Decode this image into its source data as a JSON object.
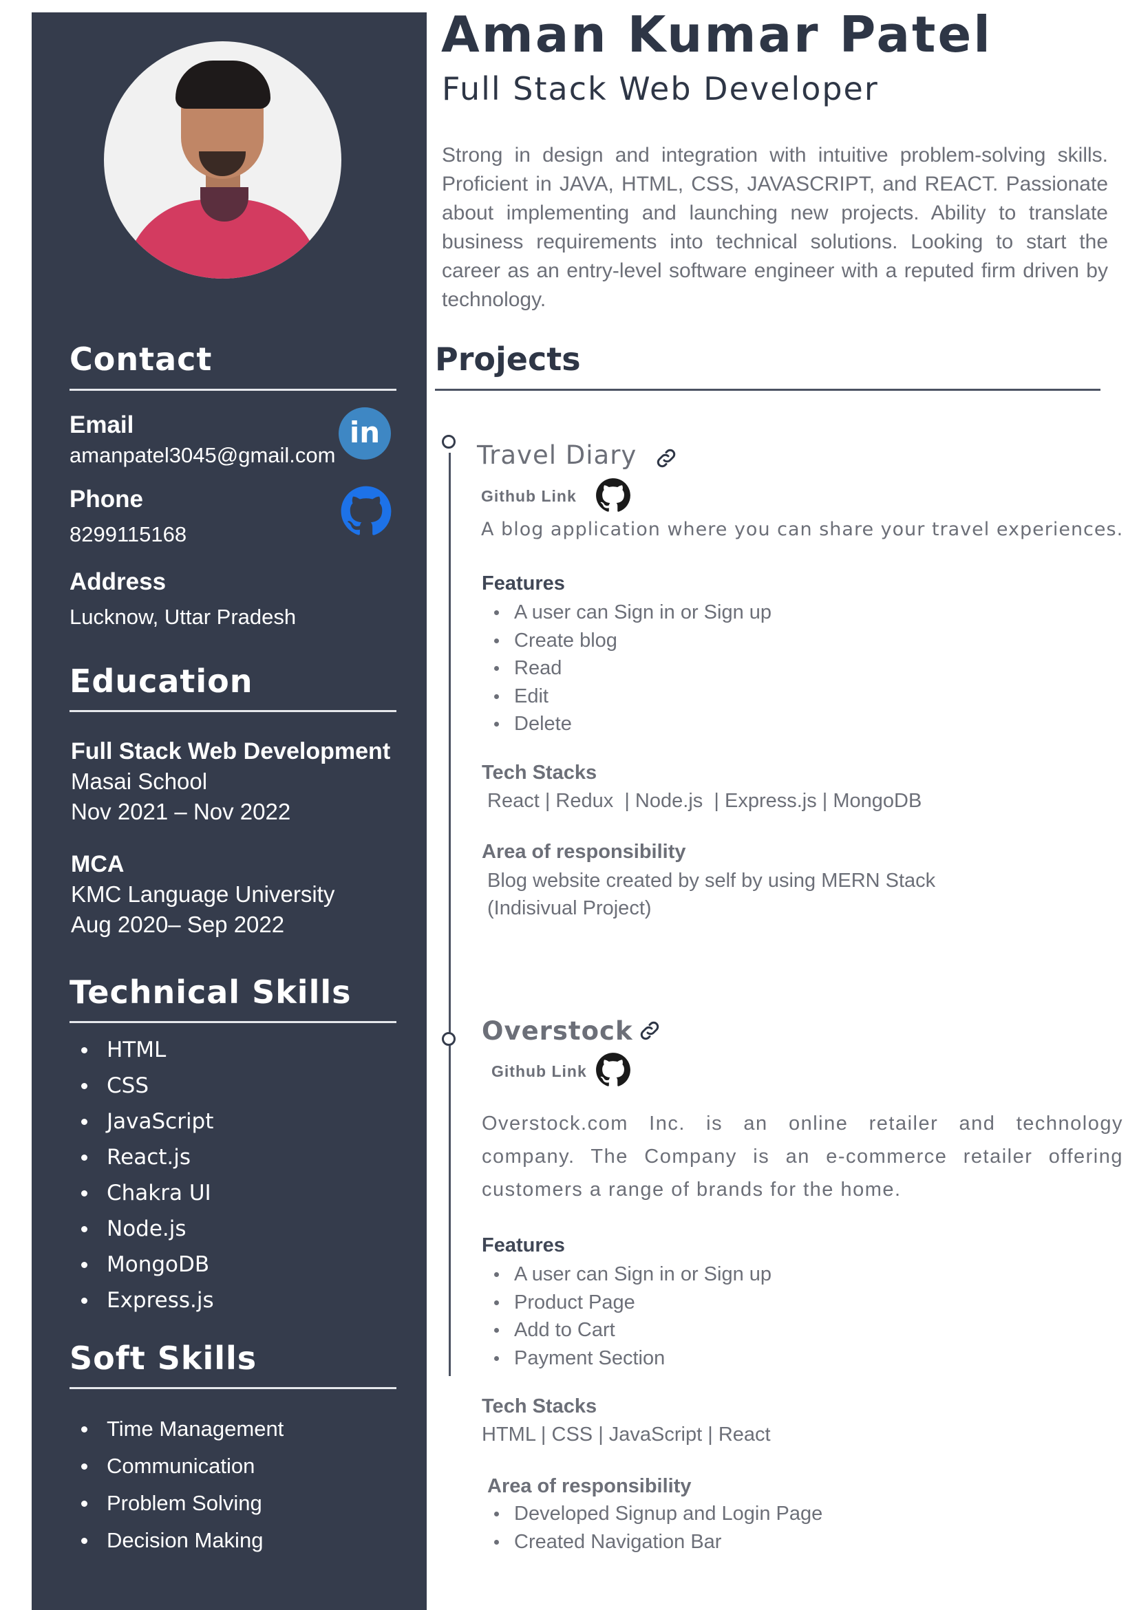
{
  "header": {
    "name": "Aman Kumar Patel",
    "role": "Full Stack Web Developer",
    "summary": "Strong in design and integration with intuitive problem-solving skills. Proficient in JAVA, HTML, CSS, JAVASCRIPT, and REACT. Passionate about implementing and launching new projects. Ability to translate business requirements into technical solutions. Looking to start the career as an entry-level software engineer with a reputed firm driven by technology."
  },
  "contact": {
    "heading": "Contact",
    "email_label": "Email",
    "email": "amanpatel3045@gmail.com",
    "phone_label": "Phone",
    "phone": "8299115168",
    "address_label": "Address",
    "address": "Lucknow, Uttar Pradesh",
    "linkedin_text": "in"
  },
  "education": {
    "heading": "Education",
    "entries": [
      {
        "degree": "Full  Stack Web Development",
        "school": "Masai School",
        "dates": "Nov 2021 – Nov 2022"
      },
      {
        "degree": "MCA",
        "school": "KMC Language University",
        "dates": "Aug 2020– Sep 2022"
      }
    ]
  },
  "technical_skills": {
    "heading": "Technical Skills",
    "items": [
      "HTML",
      "CSS",
      "JavaScript",
      "React.js",
      "Chakra UI",
      "Node.js",
      "MongoDB",
      "Express.js"
    ]
  },
  "soft_skills": {
    "heading": "Soft Skills",
    "items": [
      "Time Management",
      "Communication",
      "Problem Solving",
      "Decision Making"
    ]
  },
  "projects": {
    "heading": "Projects",
    "items": [
      {
        "title": "Travel Diary",
        "github_label": "Github Link",
        "description": "A blog application where you can share your travel experiences.",
        "features_label": "Features",
        "features": [
          "A user can Sign in or Sign up",
          "Create blog",
          "Read",
          "Edit",
          "Delete"
        ],
        "tech_label": "Tech Stacks",
        "tech": "React | Redux  | Node.js  | Express.js | MongoDB",
        "responsibility_label": "Area of responsibility",
        "responsibility": [
          "Blog website created by self by using MERN Stack",
          "(Indisivual Project)"
        ]
      },
      {
        "title": "Overstock",
        "github_label": "Github Link",
        "description": "Overstock.com Inc. is an online retailer and technology company. The Company is an e-commerce retailer offering customers a range of brands for the home.",
        "features_label": "Features",
        "features": [
          "A user can Sign in or Sign up",
          "Product Page",
          "Add to Cart",
          "Payment Section"
        ],
        "tech_label": "Tech Stacks",
        "tech": "HTML | CSS | JavaScript | React",
        "responsibility_label": "Area of responsibility",
        "responsibility": [
          "Developed Signup and Login Page",
          "Created Navigation Bar"
        ]
      }
    ]
  },
  "colors": {
    "sidebar": "#353c4c",
    "heading_text": "#2e3646",
    "body_text": "#6c6f78",
    "linkedin": "#3e87c4",
    "github": "#1d72e8"
  },
  "icons": [
    "linkedin-icon",
    "github-icon",
    "link-icon",
    "timeline-dot-icon"
  ]
}
